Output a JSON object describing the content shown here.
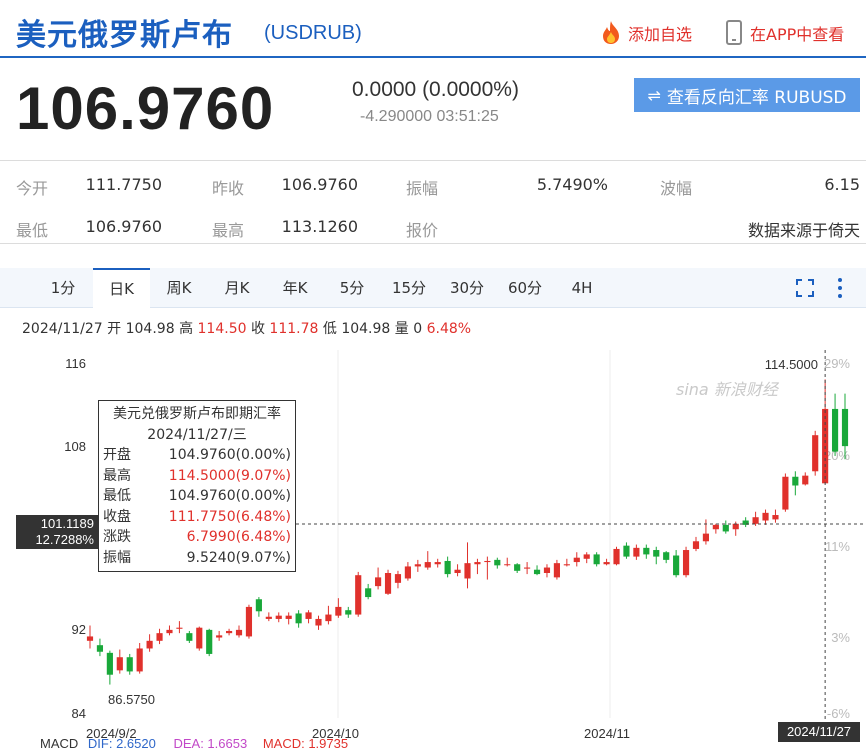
{
  "header": {
    "title": "美元俄罗斯卢布",
    "symbol": "(USDRUB)",
    "add_watchlist": "添加自选",
    "open_app": "在APP中查看"
  },
  "quote": {
    "price": "106.9760",
    "change": "0.0000 (0.0000%)",
    "sub_change": "-4.290000 03:51:25",
    "reverse_button": "查看反向汇率 RUBUSD"
  },
  "stats": {
    "open_label": "今开",
    "open_value": "111.7750",
    "prev_close_label": "昨收",
    "prev_close_value": "106.9760",
    "amplitude_label": "振幅",
    "amplitude_value": "5.7490%",
    "wave_label": "波幅",
    "wave_value": "6.15",
    "low_label": "最低",
    "low_value": "106.9760",
    "high_label": "最高",
    "high_value": "113.1260",
    "quote_label": "报价",
    "source": "数据来源于倚天"
  },
  "tabs": [
    "1分",
    "日K",
    "周K",
    "月K",
    "年K",
    "5分",
    "15分",
    "30分",
    "60分",
    "4H"
  ],
  "active_tab": "日K",
  "ohlc_line": {
    "date": "2024/11/27",
    "open_label": "开",
    "open": "104.98",
    "high_label": "高",
    "high": "114.50",
    "close_label": "收",
    "close": "111.78",
    "low_label": "低",
    "low": "104.98",
    "vol_label": "量",
    "vol": "0",
    "pct": "6.48%"
  },
  "tooltip": {
    "title": "美元兑俄罗斯卢布即期汇率",
    "date": "2024/11/27/三",
    "rows": [
      {
        "label": "开盘",
        "value": "104.9760(0.00%)",
        "color": "#333333"
      },
      {
        "label": "最高",
        "value": "114.5000(9.07%)",
        "color": "#e0312c"
      },
      {
        "label": "最低",
        "value": "104.9760(0.00%)",
        "color": "#333333"
      },
      {
        "label": "收盘",
        "value": "111.7750(6.48%)",
        "color": "#e0312c"
      },
      {
        "label": "涨跌",
        "value": "6.7990(6.48%)",
        "color": "#e0312c"
      },
      {
        "label": "振幅",
        "value": "9.5240(9.07%)",
        "color": "#333333"
      }
    ]
  },
  "crosshair": {
    "price": "101.1189",
    "pct": "12.7288%",
    "date": "2024/11/27"
  },
  "watermark": {
    "brand": "sina 新浪财经"
  },
  "macd": {
    "label": "MACD",
    "dif": "DIF: 2.6520",
    "dea": "DEA: 1.6653",
    "macd": "MACD: 1.9735"
  },
  "colors": {
    "up": "#e0312c",
    "down": "#19a83a",
    "accent": "#1b5fbf",
    "button": "#5b9ae7"
  },
  "chart_data": {
    "type": "candlestick",
    "y_ticks": [
      "116",
      "108",
      "92",
      "84"
    ],
    "ylim": [
      84,
      116
    ],
    "pct_ticks": [
      "29%",
      "20%",
      "11%",
      "3%",
      "-6%"
    ],
    "x_ticks": [
      "2024/9/2",
      "2024/10",
      "2024/11"
    ],
    "max_label": "114.5000",
    "min_label": "86.5750",
    "candles": [
      [
        90.6,
        91.0,
        92.0,
        89.9
      ],
      [
        90.2,
        89.6,
        90.8,
        89.2
      ],
      [
        89.5,
        87.5,
        89.7,
        86.6
      ],
      [
        87.9,
        89.1,
        89.8,
        87.6
      ],
      [
        89.1,
        87.8,
        89.4,
        87.5
      ],
      [
        87.8,
        89.9,
        90.4,
        87.6
      ],
      [
        89.9,
        90.6,
        91.2,
        89.6
      ],
      [
        90.6,
        91.3,
        91.7,
        90.3
      ],
      [
        91.3,
        91.6,
        92.0,
        91.1
      ],
      [
        91.7,
        91.8,
        92.4,
        91.3
      ],
      [
        91.3,
        90.6,
        91.5,
        90.4
      ],
      [
        89.9,
        91.8,
        91.9,
        89.7
      ],
      [
        91.6,
        89.4,
        91.7,
        89.2
      ],
      [
        90.9,
        91.1,
        91.5,
        90.6
      ],
      [
        91.3,
        91.5,
        91.7,
        91.1
      ],
      [
        91.1,
        91.6,
        92.0,
        90.9
      ],
      [
        91.0,
        93.7,
        93.9,
        90.8
      ],
      [
        94.4,
        93.3,
        94.6,
        92.8
      ],
      [
        92.6,
        92.8,
        93.2,
        92.4
      ],
      [
        92.6,
        92.9,
        93.2,
        92.3
      ],
      [
        92.6,
        92.9,
        93.2,
        92.1
      ],
      [
        93.1,
        92.2,
        93.4,
        91.8
      ],
      [
        92.6,
        93.2,
        93.4,
        92.2
      ],
      [
        92.0,
        92.6,
        92.9,
        91.6
      ],
      [
        92.4,
        93.0,
        93.8,
        92.1
      ],
      [
        92.9,
        93.7,
        94.5,
        92.7
      ],
      [
        93.4,
        93.0,
        93.7,
        92.7
      ],
      [
        93.0,
        96.6,
        96.9,
        92.8
      ],
      [
        95.4,
        94.6,
        95.8,
        94.4
      ],
      [
        95.6,
        96.4,
        97.3,
        95.3
      ],
      [
        94.9,
        96.8,
        97.1,
        94.8
      ],
      [
        95.9,
        96.7,
        97.0,
        95.4
      ],
      [
        96.3,
        97.4,
        97.8,
        96.1
      ],
      [
        97.4,
        97.6,
        98.0,
        96.9
      ],
      [
        97.3,
        97.8,
        98.8,
        97.1
      ],
      [
        97.6,
        97.8,
        98.1,
        97.3
      ],
      [
        97.9,
        96.7,
        98.3,
        96.4
      ],
      [
        96.8,
        97.1,
        97.6,
        96.5
      ],
      [
        96.3,
        97.7,
        99.6,
        95.4
      ],
      [
        97.6,
        97.8,
        98.1,
        96.7
      ],
      [
        97.8,
        97.9,
        98.3,
        96.2
      ],
      [
        98.0,
        97.5,
        98.2,
        97.2
      ],
      [
        97.6,
        97.6,
        98.2,
        97.4
      ],
      [
        97.6,
        97.0,
        97.7,
        96.8
      ],
      [
        97.2,
        97.3,
        97.8,
        96.7
      ],
      [
        97.1,
        96.7,
        97.5,
        96.6
      ],
      [
        96.8,
        97.3,
        97.6,
        96.4
      ],
      [
        96.4,
        97.7,
        98.0,
        96.2
      ],
      [
        97.5,
        97.6,
        98.1,
        97.4
      ],
      [
        97.8,
        98.2,
        98.7,
        97.4
      ],
      [
        98.1,
        98.5,
        98.7,
        97.7
      ],
      [
        98.5,
        97.6,
        98.7,
        97.4
      ],
      [
        97.6,
        97.8,
        98.1,
        97.5
      ],
      [
        97.6,
        99.0,
        99.2,
        97.5
      ],
      [
        99.3,
        98.3,
        99.6,
        98.1
      ],
      [
        98.3,
        99.1,
        99.4,
        98.0
      ],
      [
        99.1,
        98.5,
        99.4,
        98.1
      ],
      [
        98.9,
        98.3,
        99.2,
        97.6
      ],
      [
        98.7,
        98.0,
        98.8,
        97.7
      ],
      [
        98.4,
        96.6,
        98.9,
        96.4
      ],
      [
        96.6,
        98.9,
        99.2,
        96.4
      ],
      [
        99.0,
        99.7,
        100.1,
        98.8
      ],
      [
        99.7,
        100.4,
        101.7,
        99.4
      ],
      [
        100.8,
        101.2,
        101.3,
        100.4
      ],
      [
        101.2,
        100.6,
        101.6,
        100.4
      ],
      [
        100.8,
        101.3,
        101.5,
        100.2
      ],
      [
        101.6,
        101.2,
        101.9,
        101.0
      ],
      [
        101.3,
        101.9,
        102.4,
        101.1
      ],
      [
        101.6,
        102.3,
        102.6,
        101.2
      ],
      [
        101.7,
        102.1,
        102.6,
        101.4
      ],
      [
        102.6,
        105.6,
        105.9,
        102.4
      ],
      [
        105.6,
        104.8,
        106.1,
        103.9
      ],
      [
        104.9,
        105.7,
        106.0,
        104.8
      ],
      [
        106.1,
        109.4,
        109.8,
        105.7
      ],
      [
        105.0,
        111.8,
        114.5,
        105.0
      ],
      [
        111.8,
        107.9,
        113.2,
        107.5
      ],
      [
        111.8,
        108.4,
        113.2,
        107.2
      ]
    ]
  }
}
